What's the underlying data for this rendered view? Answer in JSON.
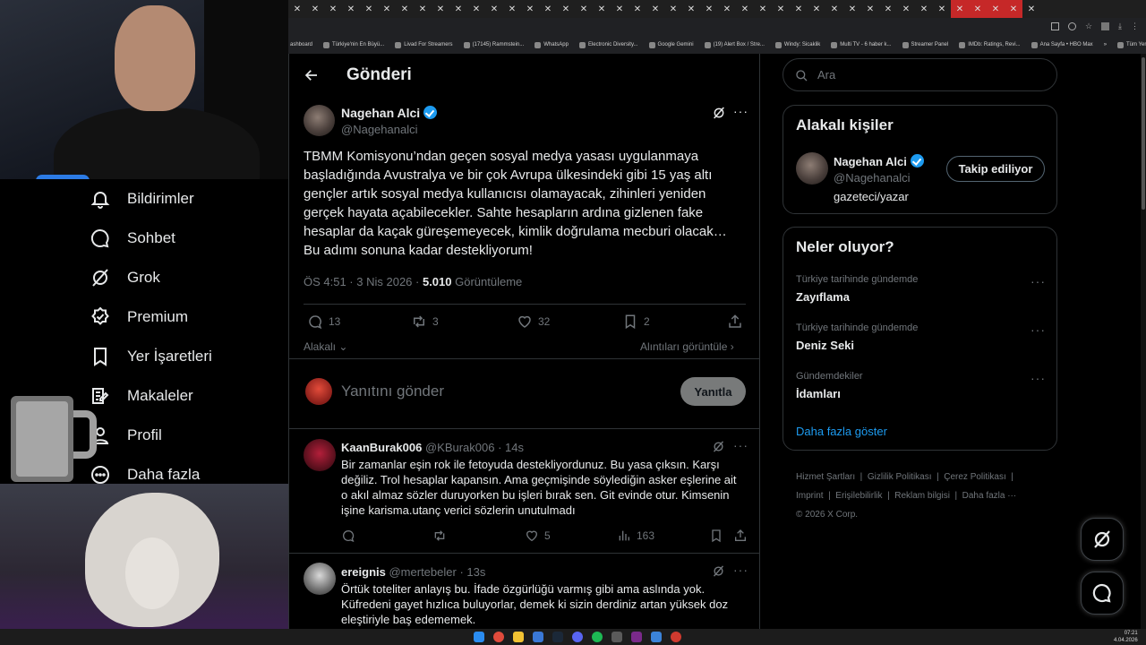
{
  "browser": {
    "bookmarks": [
      "ashboard",
      "Türkiye'nin En Büyü...",
      "Livad For Streamers",
      "(17145) Rammstein...",
      "WhatsApp",
      "Electronic Diversity...",
      "Google Gemini",
      "(19) Alert Box / Stre...",
      "Windy: Sicaklik",
      "Multi TV - 6 haber k...",
      "Streamer Panel",
      "IMDb: Ratings, Revi...",
      "Ana Sayfa • HBO Max",
      "Tüm Yer İşaretleri"
    ],
    "bookmarks_overflow": "»"
  },
  "sidebar": {
    "items": [
      {
        "label": "Bildirimler",
        "icon": "bell-icon"
      },
      {
        "label": "Sohbet",
        "icon": "chat-icon"
      },
      {
        "label": "Grok",
        "icon": "grok-icon"
      },
      {
        "label": "Premium",
        "icon": "premium-icon"
      },
      {
        "label": "Yer İşaretleri",
        "icon": "bookmark-icon"
      },
      {
        "label": "Makaleler",
        "icon": "article-icon"
      },
      {
        "label": "Profil",
        "icon": "profile-icon"
      },
      {
        "label": "Daha fazla",
        "icon": "more-icon"
      }
    ]
  },
  "header": {
    "title": "Gönderi"
  },
  "post": {
    "author_name": "Nagehan Alci",
    "author_handle": "@Nagehanalci",
    "text": "TBMM Komisyonu’ndan geçen sosyal medya yasası uygulanmaya başladığında Avustralya ve bir çok Avrupa ülkesindeki gibi 15 yaş altı gençler artık sosyal medya kullanıcısı olamayacak, zihinleri yeniden gerçek hayata açabilecekler. Sahte hesapların ardına gizlenen fake hesaplar da kaçak güreşemeyecek, kimlik doğrulama mecburi olacak… Bu adımı sonuna kadar destekliyorum!",
    "time": "ÖS 4:51 · 3 Nis 2026 ·",
    "views": "5.010",
    "views_label": "Görüntüleme",
    "replies": "13",
    "reposts": "3",
    "likes": "32",
    "bookmarks": "2",
    "relevance": "Alakalı",
    "quotes_link": "Alıntıları görüntüle"
  },
  "composer": {
    "placeholder": "Yanıtını gönder",
    "button": "Yanıtla"
  },
  "replies": [
    {
      "name": "KaanBurak006",
      "handle": "@KBurak006",
      "time": "· 14s",
      "text": "Bir zamanlar eşin rok ile fetoyuda destekliyordunuz. Bu yasa çıksın. Karşı değiliz. Trol hesaplar kapansın. Ama geçmişinde söylediğin asker eşlerine ait o akıl almaz sözler duruyorken bu işleri bırak sen. Git evinde otur. Kimsenin işine karisma.utanç verici sözlerin unutulmadı",
      "likes": "5",
      "views": "163"
    },
    {
      "name": "ereignis",
      "handle": "@mertebeler",
      "time": "· 13s",
      "text": "Örtük toteliter anlayış bu. İfade özgürlüğü varmış gibi ama aslında yok. Küfredeni gayet hızlıca buluyorlar, demek ki sizin derdiniz artan yüksek doz eleştiriyle baş edememek."
    }
  ],
  "right": {
    "search_placeholder": "Ara",
    "related_title": "Alakalı kişiler",
    "person_name": "Nagehan Alci",
    "person_handle": "@Nagehanalci",
    "person_bio": "gazeteci/yazar",
    "follow_label": "Takip ediliyor",
    "trends_title": "Neler oluyor?",
    "trends": [
      {
        "category": "Türkiye tarihinde gündemde",
        "name": "Zayıflama"
      },
      {
        "category": "Türkiye tarihinde gündemde",
        "name": "Deniz Seki"
      },
      {
        "category": "Gündemdekiler",
        "name": "İdamları"
      }
    ],
    "show_more": "Daha fazla göster",
    "footer_links": [
      "Hizmet Şartları",
      "Gizlilik Politikası",
      "Çerez Politikası",
      "Imprint",
      "Erişilebilirlik",
      "Reklam bilgisi",
      "Daha fazla ···"
    ],
    "copyright": "© 2026 X Corp."
  },
  "taskbar": {
    "time": "07:21",
    "date": "4.04.2026"
  },
  "colors": {
    "accent": "#1d9bf0",
    "border": "#2f3336",
    "muted": "#71767b"
  }
}
